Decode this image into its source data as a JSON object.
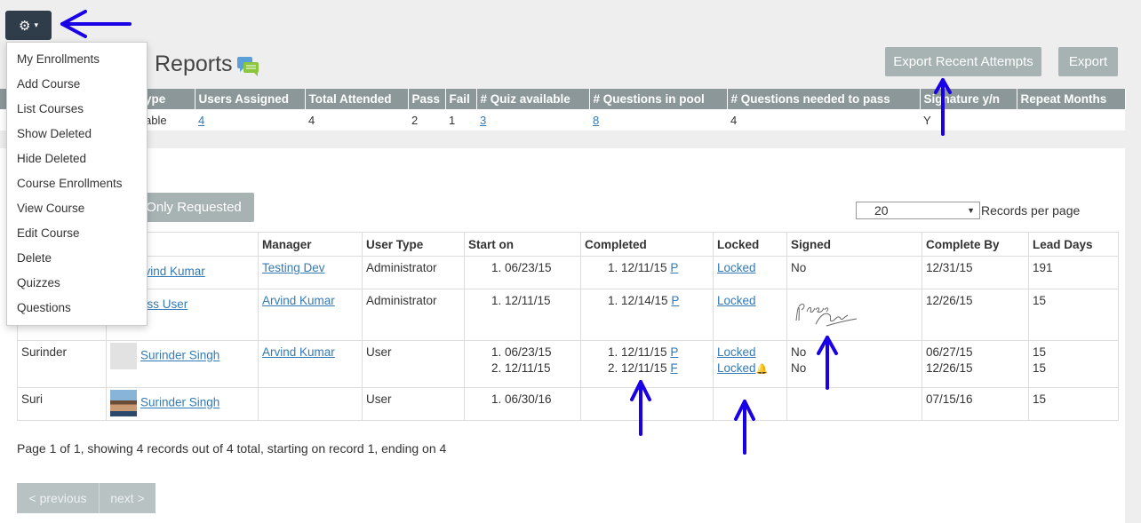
{
  "gear_button": {
    "icon": "gear-icon",
    "caret": "▾"
  },
  "title": {
    "text": "Reports",
    "icon": "chat-bubbles-icon"
  },
  "buttons": {
    "export_recent": "Export Recent Attempts",
    "export": "Export",
    "only_requested": "Only Requested"
  },
  "summary": {
    "headers": [
      "ype",
      "Users Assigned",
      "Total Attended",
      "Pass",
      "Fail",
      "# Quiz available",
      "# Questions in pool",
      "# Questions needed to pass",
      "Signature y/n",
      "Repeat Months"
    ],
    "row": [
      "able",
      "4",
      "4",
      "2",
      "1",
      "3",
      "8",
      "4",
      "Y",
      ""
    ]
  },
  "per_page": {
    "value": "20",
    "label": "Records per page"
  },
  "grid": {
    "headers": [
      "",
      "",
      "Manager",
      "User Type",
      "Start on",
      "Completed",
      "Locked",
      "Signed",
      "Complete By",
      "Lead Days"
    ],
    "rows": [
      {
        "username": "",
        "name": "rvind Kumar",
        "manager": "Testing Dev",
        "user_type": "Administrator",
        "start": [
          "1. 06/23/15"
        ],
        "completed": [
          "1. 12/11/15"
        ],
        "completed_status": [
          "P"
        ],
        "locked": [
          "Locked"
        ],
        "signed": [
          "No"
        ],
        "complete_by": [
          "12/31/15"
        ],
        "lead_days": [
          "191"
        ]
      },
      {
        "username": "",
        "name": "ass User",
        "manager": "Arvind Kumar",
        "user_type": "Administrator",
        "start": [
          "1. 12/11/15"
        ],
        "completed": [
          "1. 12/14/15"
        ],
        "completed_status": [
          "P"
        ],
        "locked": [
          "Locked"
        ],
        "signed": [],
        "complete_by": [
          "12/26/15"
        ],
        "lead_days": [
          "15"
        ]
      },
      {
        "username": "Surinder",
        "name": "Surinder Singh",
        "manager": "Arvind Kumar",
        "user_type": "User",
        "start": [
          "1. 06/23/15",
          "2. 12/11/15"
        ],
        "completed": [
          "1. 12/11/15",
          "2. 12/11/15"
        ],
        "completed_status": [
          "P",
          "F"
        ],
        "locked": [
          "Locked",
          "Locked"
        ],
        "signed": [
          "No",
          "No"
        ],
        "complete_by": [
          "06/27/15",
          "12/26/15"
        ],
        "lead_days": [
          "15",
          "15"
        ]
      },
      {
        "username": "Suri",
        "name": "Surinder Singh",
        "manager": "",
        "user_type": "User",
        "start": [
          "1. 06/30/16"
        ],
        "completed": [],
        "completed_status": [],
        "locked": [],
        "signed": [],
        "complete_by": [
          "07/15/16"
        ],
        "lead_days": [
          "15"
        ]
      }
    ]
  },
  "paging_text": "Page 1 of 1, showing 4 records out of 4 total, starting on record 1, ending on 4",
  "pager": {
    "previous": "< previous",
    "next": "next >"
  },
  "menu": [
    "My Enrollments",
    "Add Course",
    "List Courses",
    "Show Deleted",
    "Hide Deleted",
    "Course Enrollments",
    "View Course",
    "Edit Course",
    "Delete",
    "Quizzes",
    "Questions"
  ],
  "colors": {
    "arrow": "#1a00e6",
    "header_bg": "#8c9799",
    "button_bg": "#a7b2b3",
    "link": "#337ab7"
  }
}
